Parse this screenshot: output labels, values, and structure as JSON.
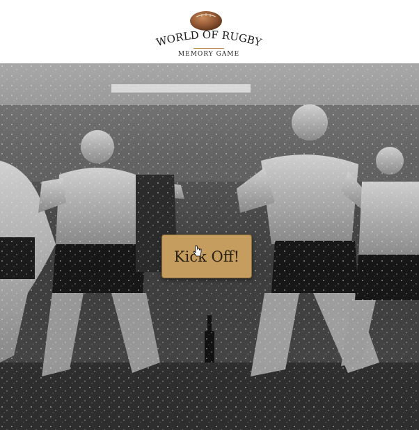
{
  "header": {
    "title": "WORLD OF RUGBY",
    "subtitle": "MEMORY GAME",
    "logo_icon": "rugby-ball-icon"
  },
  "hero": {
    "image": "haka-team-in-rain-photo"
  },
  "start_button": {
    "label": "Kick Off!"
  },
  "colors": {
    "button_bg": "#c59d5f",
    "button_text": "#2a2012",
    "accent_rule": "#b88a3d",
    "header_bg": "#ffffff"
  }
}
